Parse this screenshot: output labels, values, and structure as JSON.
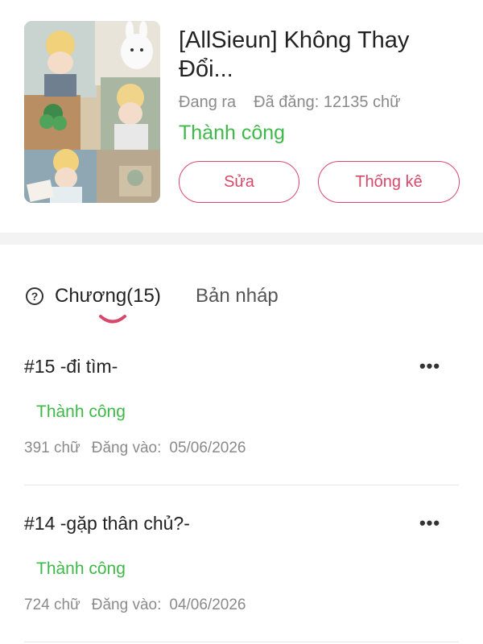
{
  "story": {
    "title": "[AllSieun] Không Thay Đổi...",
    "state": "Đang ra",
    "published_words": "Đã đăng: 12135 chữ",
    "status": "Thành công",
    "edit_label": "Sửa",
    "stats_label": "Thống kê"
  },
  "tabs": {
    "chapters_label": "Chương(15)",
    "drafts_label": "Bản nháp",
    "help_icon": "question-circle-icon"
  },
  "chapters": [
    {
      "title": "#15  -đi tìm-",
      "status": "Thành công",
      "words": "391 chữ",
      "posted_label": "Đăng vào:",
      "date": "05/06/2026"
    },
    {
      "title": "#14  -gặp thân chủ?-",
      "status": "Thành công",
      "words": "724 chữ",
      "posted_label": "Đăng vào:",
      "date": "04/06/2026"
    }
  ],
  "colors": {
    "accent": "#d9486a",
    "success": "#3fb84a",
    "muted": "#8a8a8a",
    "band": "#f3f3f3"
  }
}
